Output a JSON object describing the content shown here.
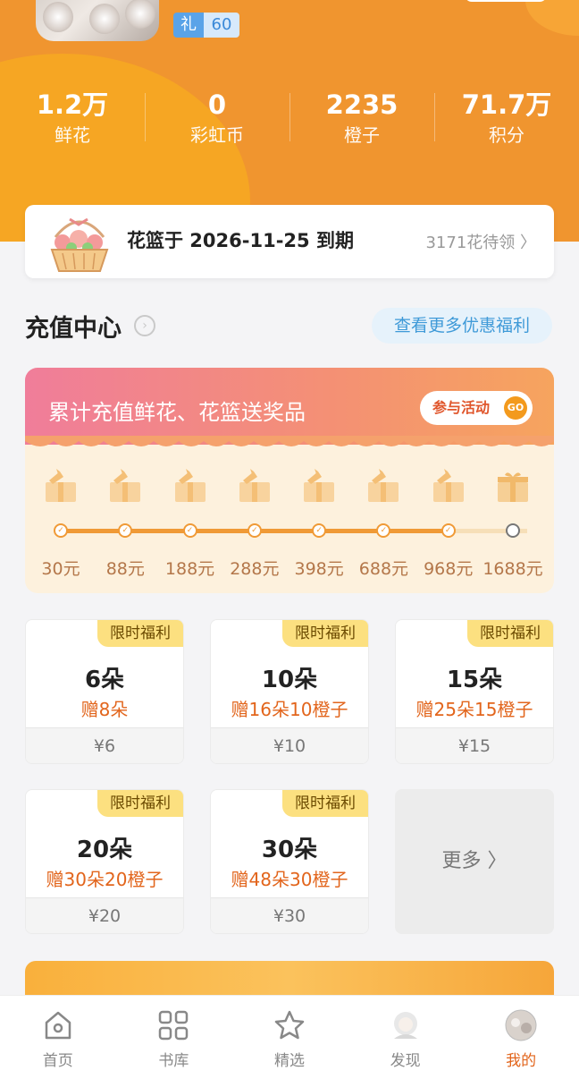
{
  "header": {
    "gift_badge": {
      "key": "礼",
      "value": "60"
    }
  },
  "stats": [
    {
      "value": "1.2万",
      "label": "鲜花"
    },
    {
      "value": "0",
      "label": "彩虹币"
    },
    {
      "value": "2235",
      "label": "橙子"
    },
    {
      "value": "71.7万",
      "label": "积分"
    }
  ],
  "basket": {
    "text": "花篮于 2026-11-25 到期",
    "right": "3171花待领 〉"
  },
  "recharge": {
    "title": "充值中心",
    "more": "查看更多优惠福利"
  },
  "promo": {
    "title": "累计充值鲜花、花篮送奖品",
    "join_label": "参与活动",
    "go_label": "GO",
    "milestones": [
      "30元",
      "88元",
      "188元",
      "288元",
      "398元",
      "688元",
      "968元",
      "1688元"
    ],
    "reached_count": 7
  },
  "packages": [
    {
      "tag": "限时福利",
      "name": "6朵",
      "bonus": "赠8朵",
      "price": "¥6"
    },
    {
      "tag": "限时福利",
      "name": "10朵",
      "bonus": "赠16朵10橙子",
      "price": "¥10"
    },
    {
      "tag": "限时福利",
      "name": "15朵",
      "bonus": "赠25朵15橙子",
      "price": "¥15"
    },
    {
      "tag": "限时福利",
      "name": "20朵",
      "bonus": "赠30朵20橙子",
      "price": "¥20"
    },
    {
      "tag": "限时福利",
      "name": "30朵",
      "bonus": "赠48朵30橙子",
      "price": "¥30"
    }
  ],
  "more_label": "更多 〉",
  "tabs": [
    {
      "label": "首页",
      "icon": "home-icon"
    },
    {
      "label": "书库",
      "icon": "grid-icon"
    },
    {
      "label": "精选",
      "icon": "star-icon"
    },
    {
      "label": "发现",
      "icon": "character-icon"
    },
    {
      "label": "我的",
      "icon": "avatar-icon",
      "active": true
    }
  ],
  "colors": {
    "header_orange": "#f0952f",
    "accent": "#e2651c",
    "tag_yellow": "#fce080",
    "link_blue": "#3f9ad8"
  }
}
